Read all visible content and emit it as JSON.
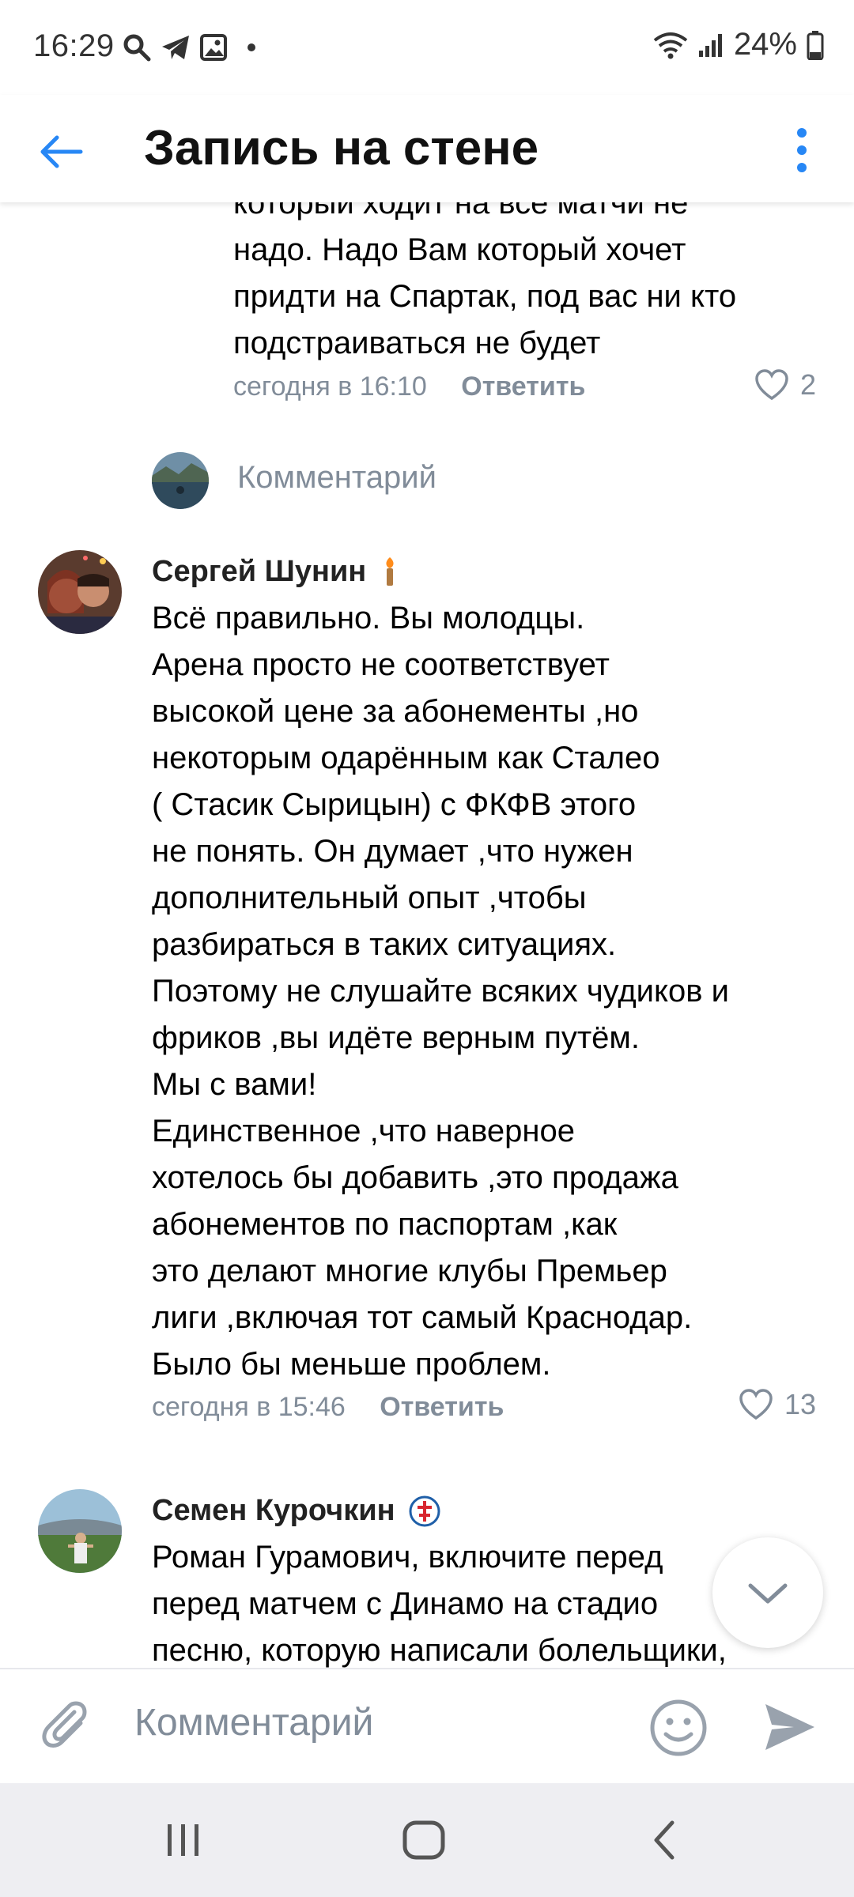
{
  "status_bar": {
    "time": "16:29",
    "battery": "24%"
  },
  "header": {
    "title": "Запись на стене"
  },
  "prev_comment": {
    "lines": [
      "который ходит на все матчи не",
      "надо. Надо Вам который хочет",
      "придти на Спартак, под вас ни кто",
      "подстраиваться не будет"
    ],
    "time": "сегодня в 16:10",
    "reply_label": "Ответить",
    "likes": "2"
  },
  "reply_composer": {
    "placeholder": "Комментарий"
  },
  "comment1": {
    "author": "Сергей Шунин",
    "lines": [
      "Всё правильно. Вы молодцы.",
      "Арена просто не соответствует",
      "высокой цене за абонементы ,но",
      "некоторым одарённым как Сталео",
      "( Стасик Сырицын) с ФКФВ этого",
      "не понять. Он думает ,что нужен",
      "дополнительный опыт ,чтобы",
      "разбираться в таких ситуациях.",
      "Поэтому не слушайте всяких чудиков и",
      "фриков ,вы идёте верным путём.",
      "Мы с вами!",
      "Единственное ,что наверное",
      "хотелось бы добавить ,это продажа",
      "абонементов по паспортам ,как",
      "это делают многие клубы Премьер",
      "лиги ,включая тот самый Краснодар.",
      "Было бы меньше проблем."
    ],
    "time": "сегодня в 15:46",
    "reply_label": "Ответить",
    "likes": "13"
  },
  "comment2": {
    "author": "Семен Курочкин",
    "lines": [
      "Роман Гурамович, включите перед",
      "перед матчем с Динамо на стадио",
      "песню, которую написали болельщики,"
    ]
  },
  "composer": {
    "placeholder": "Комментарий"
  },
  "colors": {
    "accent": "#2787f5",
    "meta": "#818c99"
  },
  "icons": [
    "back-arrow-icon",
    "more-vertical-icon",
    "heart-icon",
    "attach-icon",
    "emoji-icon",
    "send-icon",
    "chevron-down-icon"
  ]
}
